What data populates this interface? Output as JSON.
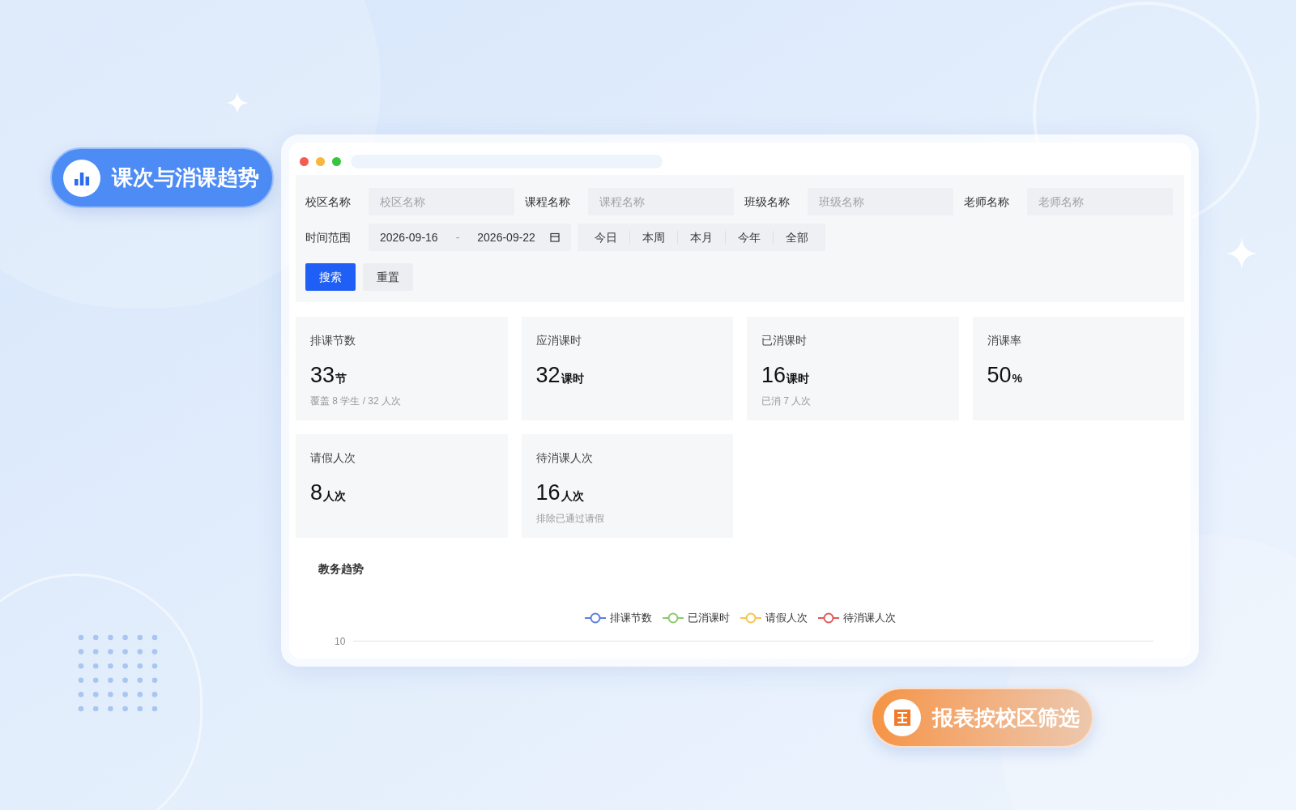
{
  "badges": [
    {
      "kind": "chart",
      "text": "课次与消课趋势"
    },
    {
      "kind": "table",
      "text": "报表按校区筛选"
    }
  ],
  "filters": [
    {
      "label": "校区名称",
      "placeholder": "校区名称"
    },
    {
      "label": "课程名称",
      "placeholder": "课程名称"
    },
    {
      "label": "班级名称",
      "placeholder": "班级名称"
    },
    {
      "label": "老师名称",
      "placeholder": "老师名称"
    }
  ],
  "date_range": {
    "label": "时间范围",
    "start": "2026-09-16",
    "separator": "-",
    "end": "2026-09-22"
  },
  "quick_ranges": [
    "今日",
    "本周",
    "本月",
    "今年",
    "全部"
  ],
  "buttons": [
    {
      "kind": "primary",
      "label": "搜索"
    },
    {
      "kind": "default",
      "label": "重置"
    }
  ],
  "stats": [
    {
      "title": "排课节数",
      "value": "33",
      "unit": "节",
      "note": "覆盖 8 学生 / 32 人次"
    },
    {
      "title": "应消课时",
      "value": "32",
      "unit": "课时"
    },
    {
      "title": "已消课时",
      "value": "16",
      "unit": "课时",
      "note": "已消 7 人次"
    },
    {
      "title": "消课率",
      "value": "50",
      "unit": "%"
    },
    {
      "title": "请假人次",
      "value": "8",
      "unit": "人次"
    },
    {
      "title": "待消课人次",
      "value": "16",
      "unit": "人次",
      "note": "排除已通过请假"
    }
  ],
  "chart": {
    "title": "教务趋势",
    "legend": [
      {
        "label": "排课节数",
        "color": "#5b7fe0"
      },
      {
        "label": "已消课时",
        "color": "#8cc96b"
      },
      {
        "label": "请假人次",
        "color": "#f5c54c"
      },
      {
        "label": "待消课人次",
        "color": "#e05a5a"
      }
    ],
    "y_tick": "10"
  }
}
